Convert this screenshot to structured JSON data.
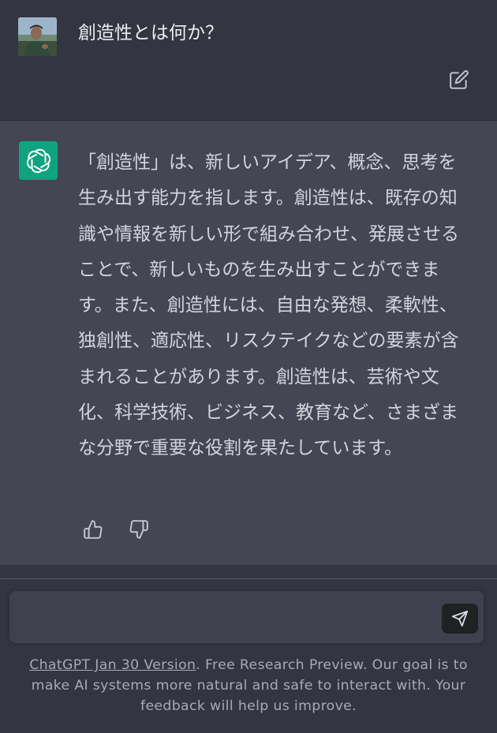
{
  "user": {
    "avatar_icon": "user-photo-avatar",
    "message": "創造性とは何か？",
    "edit_icon": "edit-pencil-icon"
  },
  "assistant": {
    "logo_icon": "openai-logo",
    "logo_color": "#10a37f",
    "message": "「創造性」は、新しいアイデア、概念、思考を生み出す能力を指します。創造性は、既存の知識や情報を新しい形で組み合わせ、発展させることで、新しいものを生み出すことができます。また、創造性には、自由な発想、柔軟性、独創性、適応性、リスクテイクなどの要素が含まれることがあります。創造性は、芸術や文化、科学技術、ビジネス、教育など、さまざまな分野で重要な役割を果たしています。",
    "thumbs_up_icon": "thumbs-up-icon",
    "thumbs_down_icon": "thumbs-down-icon"
  },
  "composer": {
    "placeholder": "",
    "value": "",
    "send_icon": "send-icon"
  },
  "footer": {
    "version_link": "ChatGPT Jan 30 Version",
    "disclaimer": ". Free Research Preview. Our goal is to make AI systems more natural and safe to interact with. Your feedback will help us improve."
  },
  "colors": {
    "background": "#343541",
    "assistant_background": "#444654",
    "accent": "#10a37f"
  }
}
